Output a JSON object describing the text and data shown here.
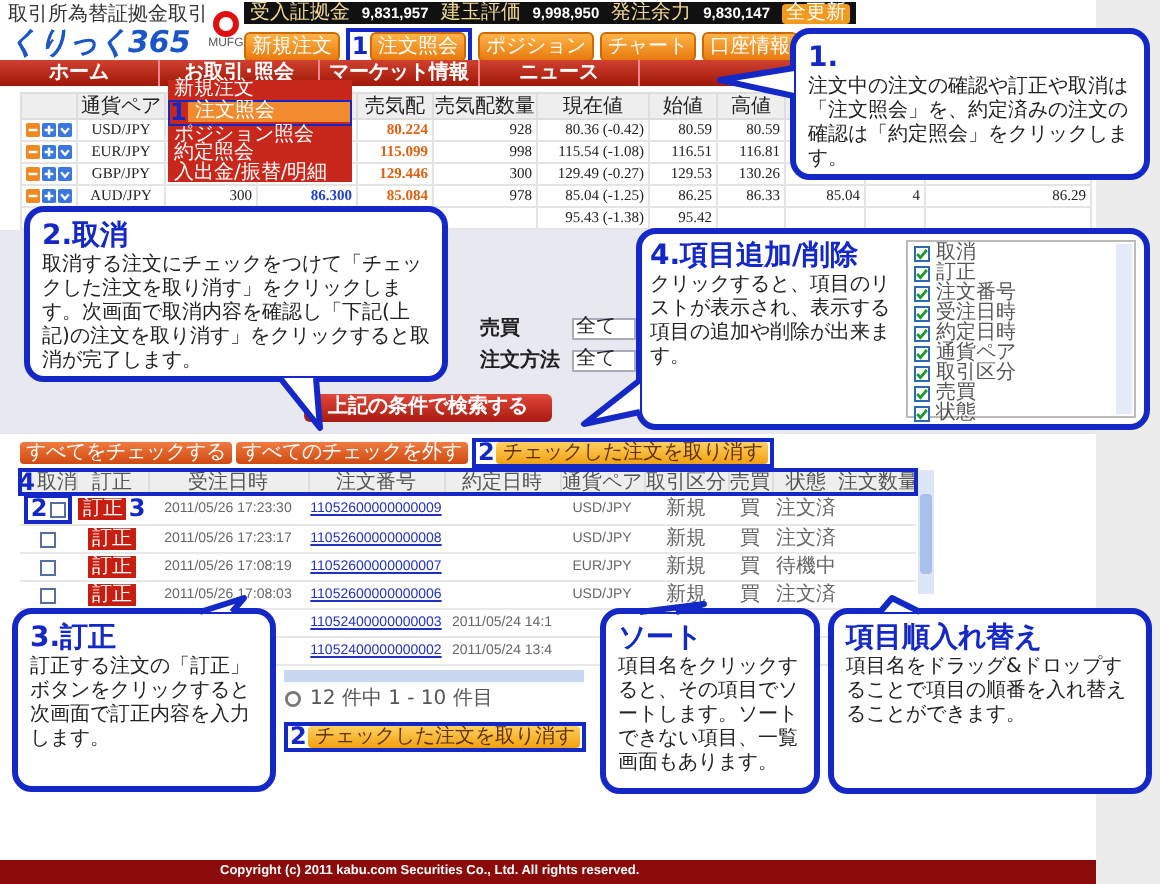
{
  "header": {
    "tagline": "取引所為替証拠金取引",
    "logo": "くりっく365",
    "bank_logo": "MUFG",
    "account": [
      {
        "label": "受入証拠金",
        "value": "9,831,957"
      },
      {
        "label": "建玉評価",
        "value": "9,998,950"
      },
      {
        "label": "発注余力",
        "value": "9,830,147"
      }
    ],
    "refresh_button": "全更新",
    "buttons": [
      {
        "label": "新規注文"
      },
      {
        "label": "注文照会",
        "marker": "1"
      },
      {
        "label": "ポジション"
      },
      {
        "label": "チャート"
      },
      {
        "label": "口座情報"
      }
    ]
  },
  "nav": {
    "tabs": [
      {
        "label": "ホーム"
      },
      {
        "label": "お取引･照会"
      },
      {
        "label": "マーケット情報"
      },
      {
        "label": "ニュース"
      }
    ]
  },
  "menu": {
    "items": [
      {
        "label": "新規注文",
        "selected": false
      },
      {
        "label": "注文照会",
        "selected": true,
        "marker": "1"
      },
      {
        "label": "ポジション照会",
        "selected": false
      },
      {
        "label": "約定照会",
        "selected": false
      },
      {
        "label": "入出金/振替/明細",
        "selected": false
      }
    ]
  },
  "rates": {
    "columns": [
      "通貨ペア",
      null,
      null,
      "売気配",
      "売気配数量",
      "現在値",
      "始値",
      "高値",
      null,
      null,
      null
    ],
    "rows": [
      {
        "cells": [
          "USD/JPY",
          null,
          null,
          "80.224",
          "928",
          "80.36 (-0.42)",
          "80.59",
          "80.59",
          null,
          null,
          null
        ]
      },
      {
        "cells": [
          "EUR/JPY",
          null,
          null,
          "115.099",
          "998",
          "115.54 (-1.08)",
          "116.51",
          "116.81",
          null,
          null,
          null
        ]
      },
      {
        "cells": [
          "GBP/JPY",
          null,
          null,
          "129.446",
          "300",
          "129.49 (-0.27)",
          "129.53",
          "130.26",
          null,
          null,
          null
        ]
      },
      {
        "cells": [
          "AUD/JPY",
          "300",
          "86.300",
          "85.084",
          "978",
          "85.04 (-1.25)",
          "86.25",
          "86.33",
          "85.04",
          "4",
          "86.29"
        ]
      },
      {
        "cells": [
          null,
          null,
          null,
          null,
          null,
          "95.43 (-1.38)",
          "95.42",
          null,
          null,
          null,
          null
        ]
      }
    ]
  },
  "search": {
    "fields": [
      {
        "label": "売買",
        "value": "全て"
      },
      {
        "label": "注文方法",
        "value": "全て"
      }
    ],
    "button": "上記の条件で検索する"
  },
  "actions": [
    {
      "label": "すべてをチェックする"
    },
    {
      "label": "すべてのチェックを外す"
    },
    {
      "label": "チェックした注文を取り消す",
      "marker": "2"
    }
  ],
  "orders": {
    "header_marker": "4",
    "columns": [
      "取消",
      "訂正",
      "受注日時",
      "注文番号",
      "約定日時",
      "通貨ペア",
      "取引区分",
      "売買",
      "状態",
      "注文数量"
    ],
    "rows": [
      {
        "checked": false,
        "check_marker": "2",
        "edit_marker": "3",
        "cells": [
          null,
          "訂正",
          "2011/05/26 17:23:30",
          "11052600000000009",
          null,
          "USD/JPY",
          "新規",
          "買",
          "注文済",
          null
        ]
      },
      {
        "checked": false,
        "cells": [
          null,
          "訂正",
          "2011/05/26 17:23:17",
          "11052600000000008",
          null,
          "USD/JPY",
          "新規",
          "買",
          "注文済",
          null
        ]
      },
      {
        "checked": false,
        "cells": [
          null,
          "訂正",
          "2011/05/26 17:08:19",
          "11052600000000007",
          null,
          "EUR/JPY",
          "新規",
          "買",
          "待機中",
          null
        ]
      },
      {
        "checked": false,
        "cells": [
          null,
          "訂正",
          "2011/05/26 17:08:03",
          "11052600000000006",
          null,
          "USD/JPY",
          "新規",
          "買",
          "注文済",
          null
        ]
      },
      {
        "cells": [
          null,
          null,
          null,
          "11052400000000003",
          "2011/05/24 14:1",
          null,
          null,
          null,
          null,
          null
        ]
      },
      {
        "cells": [
          null,
          null,
          null,
          "11052400000000002",
          "2011/05/24 13:4",
          null,
          null,
          null,
          null,
          null
        ]
      }
    ]
  },
  "pagination": {
    "text": "12 件中 1 - 10 件目",
    "button": "チェックした注文を取り消す",
    "marker": "2"
  },
  "footer": "Copyright (c) 2011 kabu.com Securities Co., Ltd. All rights reserved.",
  "callouts": [
    {
      "title": "1.",
      "text": "注文中の注文の確認や訂正や取消は「注文照会」を、約定済みの注文の確認は「約定照会」をクリックします。"
    },
    {
      "title": "2.取消",
      "text": "取消する注文にチェックをつけて「チェックした注文を取り消す」をクリックします。次画面で取消内容を確認し「下記(上記)の注文を取り消す」をクリックすると取消が完了します。"
    },
    {
      "title": "4.項目追加/削除",
      "text": "クリックすると、項目のリストが表示され、表示する項目の追加や削除が出来ます。",
      "column_list": [
        {
          "label": "取消",
          "checked": true
        },
        {
          "label": "訂正",
          "checked": true
        },
        {
          "label": "注文番号",
          "checked": true
        },
        {
          "label": "受注日時",
          "checked": true
        },
        {
          "label": "約定日時",
          "checked": true
        },
        {
          "label": "通貨ペア",
          "checked": true
        },
        {
          "label": "取引区分",
          "checked": true
        },
        {
          "label": "売買",
          "checked": true
        },
        {
          "label": "状態",
          "checked": true
        }
      ]
    },
    {
      "title": "3.訂正",
      "text": "訂正する注文の「訂正」ボタンをクリックすると次画面で訂正内容を入力します。"
    },
    {
      "title": "ソート",
      "text": "項目名をクリックすると、その項目でソートします。ソートできない項目、一覧画面もあります。"
    },
    {
      "title": "項目順入れ替え",
      "text": "項目名をドラッグ&ドロップすることで項目の順番を入れ替えることができます。"
    }
  ]
}
